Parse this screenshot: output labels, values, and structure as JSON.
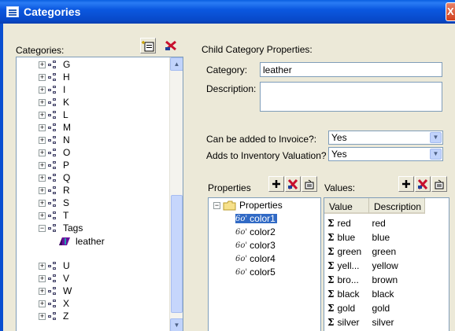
{
  "window": {
    "title": "Categories",
    "close_glyph": "X"
  },
  "left": {
    "label": "Categories:",
    "tree_items": [
      "G",
      "H",
      "I",
      "K",
      "L",
      "M",
      "N",
      "O",
      "P",
      "Q",
      "R",
      "S",
      "T",
      "Tags",
      "leather",
      "U",
      "V",
      "W",
      "X",
      "Z"
    ],
    "expander_plus": "+",
    "expander_minus": "−"
  },
  "right": {
    "section_label": "Child Category Properties:",
    "category_label": "Category:",
    "category_value": "leather",
    "description_label": "Description:",
    "description_value": "",
    "invoice_label": "Can be added to Invoice?:",
    "invoice_value": "Yes",
    "inventory_label": "Adds to Inventory Valuation?",
    "inventory_value": "Yes",
    "properties_label": "Properties",
    "values_label": "Values:",
    "properties_root": "Properties",
    "properties_items": [
      "color1",
      "color2",
      "color3",
      "color4",
      "color5"
    ],
    "values_headers": [
      "Value",
      "Description"
    ],
    "values_rows": [
      {
        "value": "red",
        "description": "red"
      },
      {
        "value": "blue",
        "description": "blue"
      },
      {
        "value": "green",
        "description": "green"
      },
      {
        "value": "yell...",
        "description": "yellow"
      },
      {
        "value": "bro...",
        "description": "brown"
      },
      {
        "value": "black",
        "description": "black"
      },
      {
        "value": "gold",
        "description": "gold"
      },
      {
        "value": "silver",
        "description": "silver"
      }
    ]
  },
  "colors": {
    "title_bar": "#0b58e0",
    "selection": "#316ac5",
    "add_icon": "#000000",
    "delete_icon": "#c8102e"
  },
  "icons": {
    "add": "plus-icon",
    "delete": "delete-icon",
    "edit": "edit-icon",
    "sigma": "Σ",
    "scroll_up": "▲",
    "scroll_down": "▼",
    "combo": "▼"
  }
}
